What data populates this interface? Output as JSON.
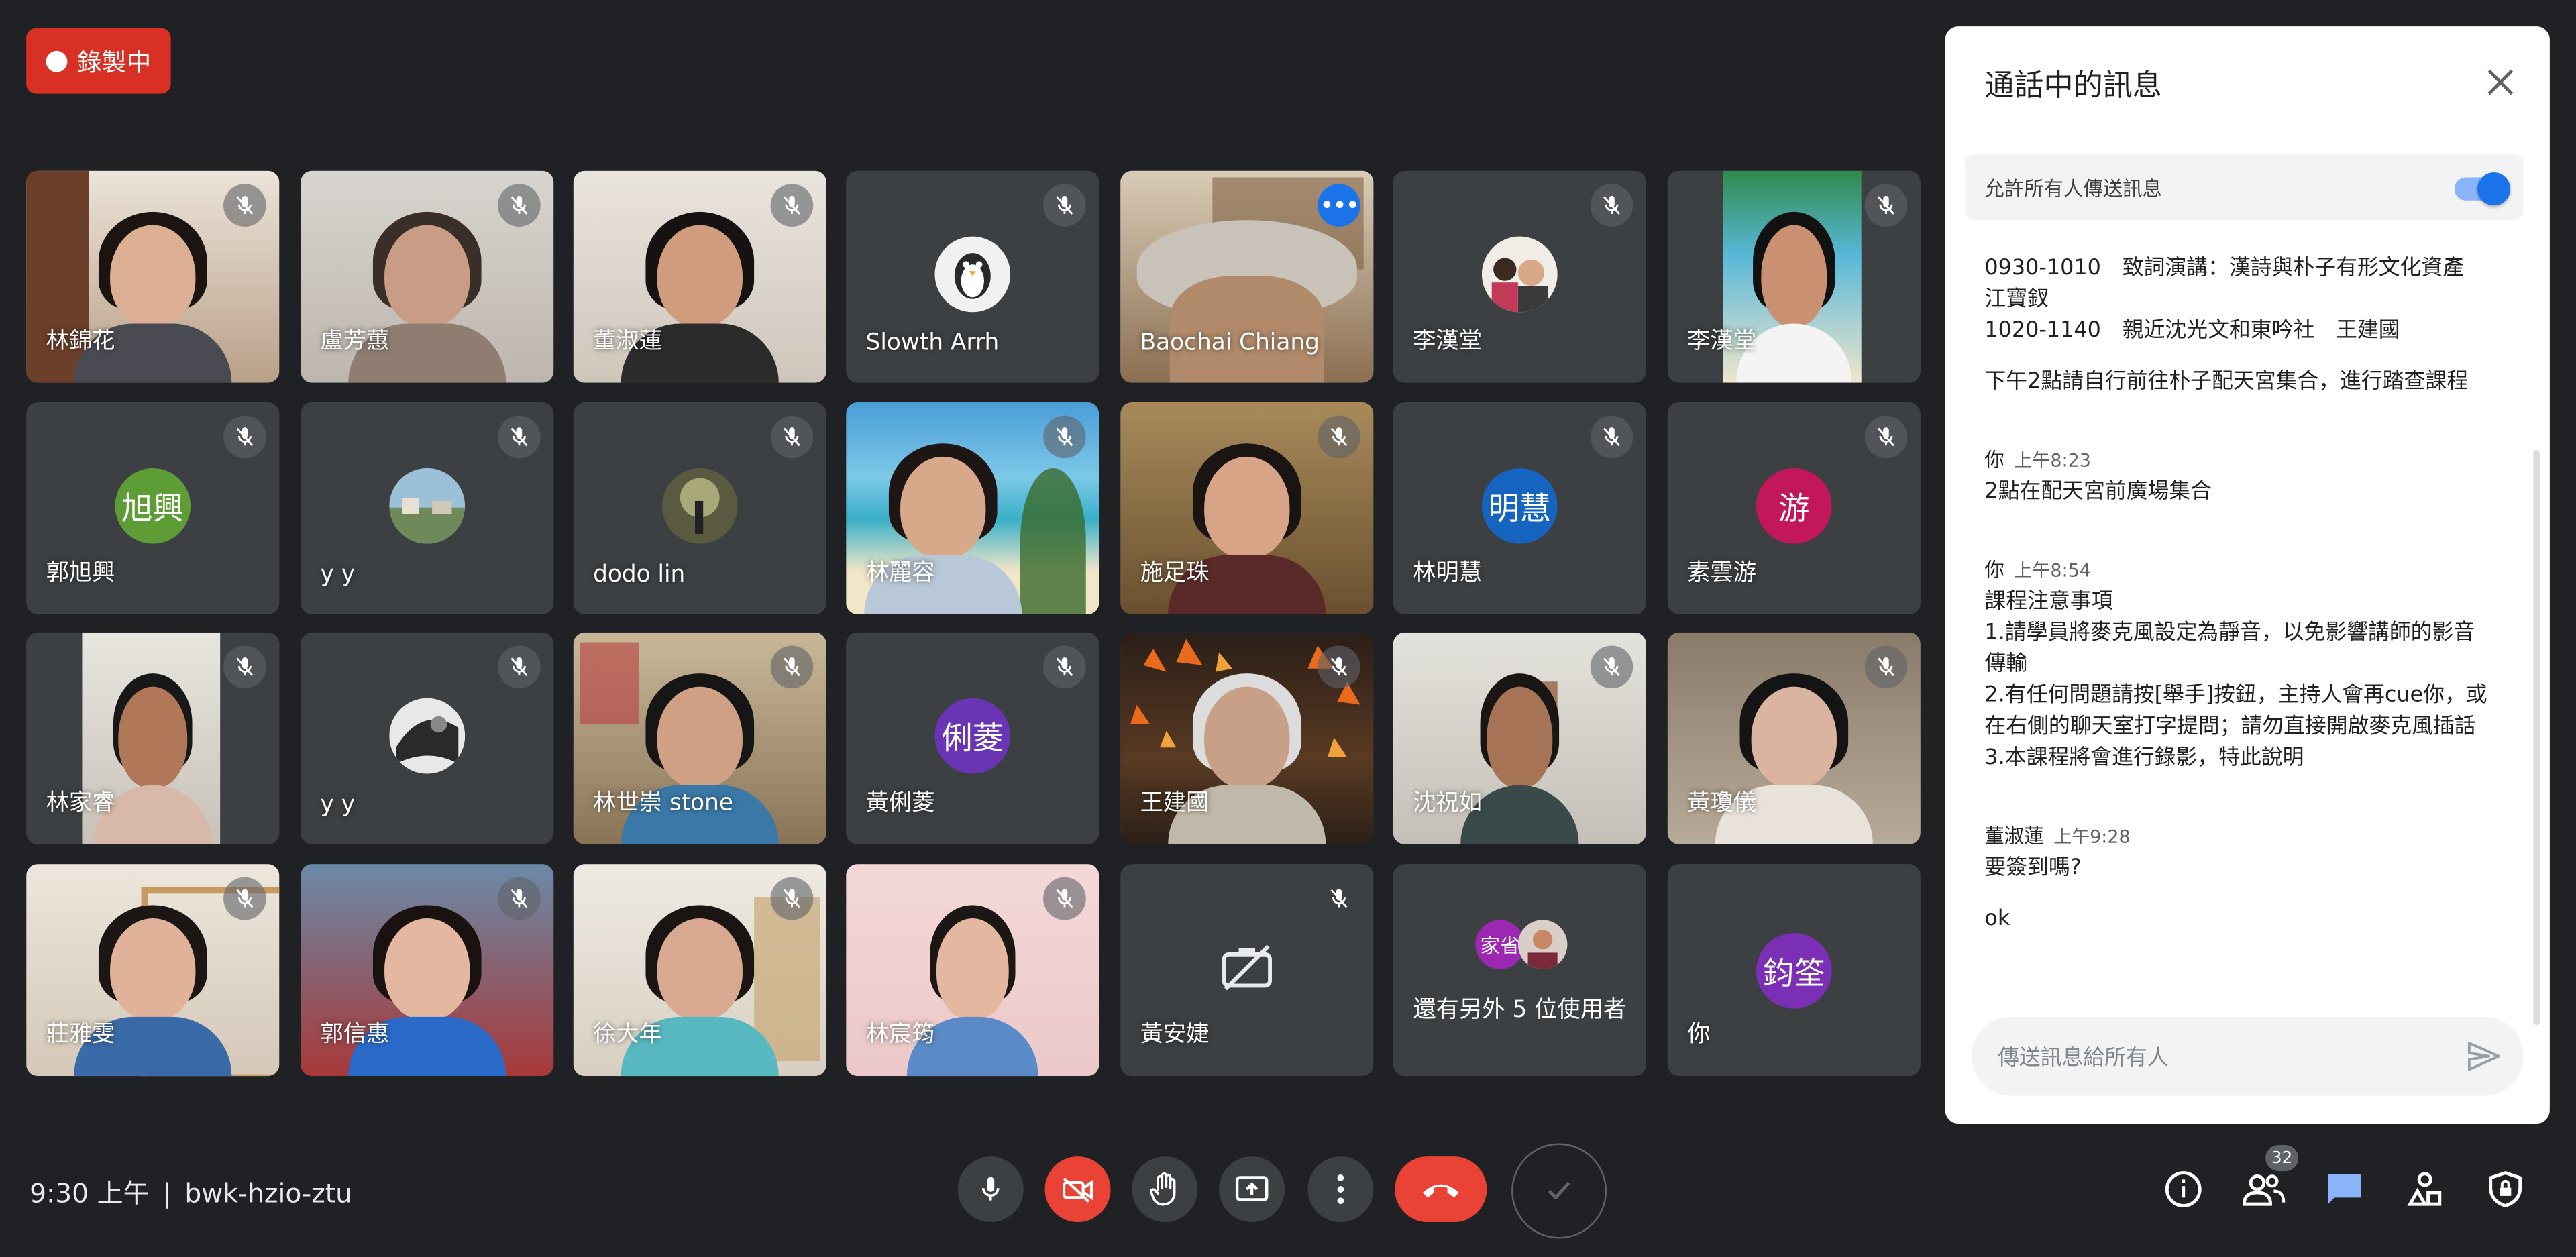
{
  "recording": {
    "label": "錄製中"
  },
  "tiles": [
    {
      "name": "林錦花"
    },
    {
      "name": "盧芳蕙"
    },
    {
      "name": "董淑蓮"
    },
    {
      "name": "Slowth Arrh"
    },
    {
      "name": "Baochai Chiang"
    },
    {
      "name": "李漢堂"
    },
    {
      "name": "李漢堂"
    },
    {
      "name": "郭旭興",
      "avatar": "旭興"
    },
    {
      "name": "y y"
    },
    {
      "name": "dodo lin"
    },
    {
      "name": "林麗容"
    },
    {
      "name": "施足珠"
    },
    {
      "name": "林明慧",
      "avatar": "明慧"
    },
    {
      "name": "素雲游",
      "avatar": "游"
    },
    {
      "name": "林家睿"
    },
    {
      "name": "y y"
    },
    {
      "name": "林世崇 stone"
    },
    {
      "name": "黃俐菱",
      "avatar": "俐菱"
    },
    {
      "name": "王建國"
    },
    {
      "name": "沈祝如"
    },
    {
      "name": "黃瓊儀"
    },
    {
      "name": "莊雅雯"
    },
    {
      "name": "郭信惠"
    },
    {
      "name": "徐大年"
    },
    {
      "name": "林宸筠"
    },
    {
      "name": "黃安婕"
    },
    {
      "name": "還有另外 5 位使用者",
      "avatar": "家省"
    },
    {
      "name": "你",
      "avatar": "鈞筌"
    }
  ],
  "chat": {
    "title": "通話中的訊息",
    "allow_label": "允許所有人傳送訊息",
    "allow_enabled": true,
    "top_lines": [
      "0930-1010　致詞演講：漢詩與朴子有形文化資產",
      "江寶釵",
      "1020-1140　親近沈光文和東吟社　王建國",
      "",
      "下午2點請自行前往朴子配天宮集合，進行踏查課程"
    ],
    "messages": [
      {
        "sender": "你",
        "time": "上午8:23",
        "lines": [
          "2點在配天宮前廣場集合"
        ]
      },
      {
        "sender": "你",
        "time": "上午8:54",
        "lines": [
          "課程注意事項",
          "1.請學員將麥克風設定為靜音，以免影響講師的影音",
          "傳輸",
          "2.有任何問題請按[舉手]按鈕，主持人會再cue你，或",
          "在右側的聊天室打字提問；請勿直接開啟麥克風插話",
          "3.本課程將會進行錄影，特此說明"
        ]
      },
      {
        "sender": "董淑蓮",
        "time": "上午9:28",
        "lines": [
          "要簽到嗎?",
          "",
          "ok"
        ]
      }
    ],
    "input_placeholder": "傳送訊息給所有人"
  },
  "footer": {
    "time": "9:30 上午",
    "separator": "|",
    "meeting_code": "bwk-hzio-ztu",
    "participants_count": "32"
  },
  "colors": {
    "background": "#202124",
    "tile": "#3c4043",
    "recording": "#d93025",
    "hangup": "#ea4335",
    "accent": "#1a73e8",
    "avatar_green": "#5e9c35",
    "avatar_blue": "#1565c0",
    "avatar_pink": "#c2185b",
    "avatar_purple": "#6a35b5"
  }
}
